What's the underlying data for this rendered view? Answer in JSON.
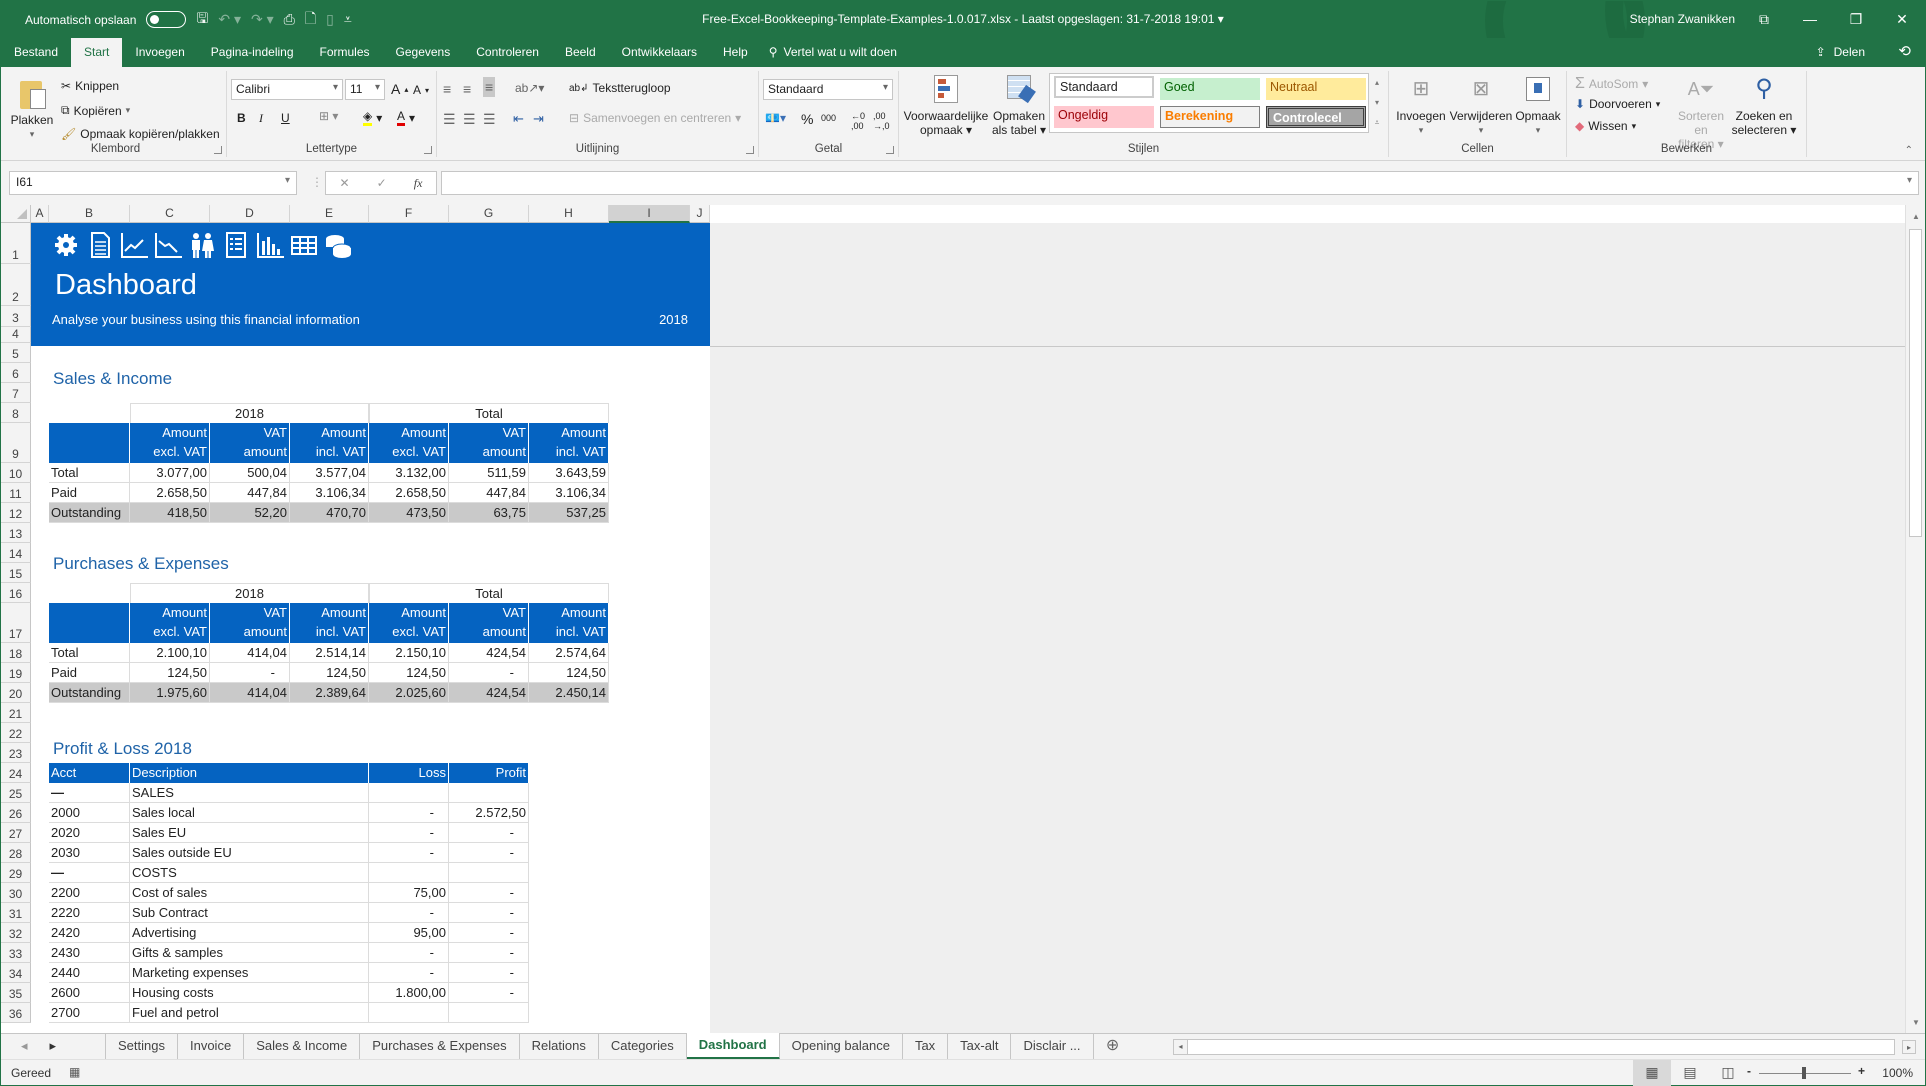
{
  "titlebar": {
    "autosave_label": "Automatisch opslaan",
    "document_title": "Free-Excel-Bookkeeping-Template-Examples-1.0.017.xlsx  -  Laatst opgeslagen: 31-7-2018 19:01",
    "user": "Stephan Zwanikken"
  },
  "ribbon_tabs": [
    "Bestand",
    "Start",
    "Invoegen",
    "Pagina-indeling",
    "Formules",
    "Gegevens",
    "Controleren",
    "Beeld",
    "Ontwikkelaars",
    "Help"
  ],
  "tell_me": "Vertel wat u wilt doen",
  "share_label": "Delen",
  "ribbon": {
    "clipboard": {
      "paste": "Plakken",
      "cut": "Knippen",
      "copy": "Kopiëren",
      "format_painter": "Opmaak kopiëren/plakken",
      "label": "Klembord"
    },
    "font": {
      "family": "Calibri",
      "size": "11",
      "bold": "B",
      "italic": "I",
      "underline": "U",
      "label": "Lettertype"
    },
    "alignment": {
      "wrap": "Tekstterugloop",
      "merge": "Samenvoegen en centreren",
      "label": "Uitlijning"
    },
    "number": {
      "format": "Standaard",
      "percent": "%",
      "thousands": "000",
      "label": "Getal"
    },
    "styles": {
      "conditional": [
        "Voorwaardelijke",
        "opmaak"
      ],
      "as_table": [
        "Opmaken",
        "als tabel"
      ],
      "cells": [
        "Standaard",
        "Goed",
        "Neutraal",
        "Ongeldig",
        "Berekening",
        "Controlecel"
      ],
      "label": "Stijlen"
    },
    "cells": {
      "insert": "Invoegen",
      "delete": "Verwijderen",
      "format": "Opmaak",
      "label": "Cellen"
    },
    "editing": {
      "autosum": "AutoSom",
      "fill": "Doorvoeren",
      "clear": "Wissen",
      "sort": [
        "Sorteren en",
        "filteren"
      ],
      "find": [
        "Zoeken en",
        "selecteren"
      ],
      "label": "Bewerken"
    }
  },
  "formula_bar": {
    "name_box": "I61",
    "fx": "fx",
    "formula": ""
  },
  "columns": [
    "A",
    "B",
    "C",
    "D",
    "E",
    "F",
    "G",
    "H",
    "I",
    "J"
  ],
  "selected_column": "I",
  "rows": [
    "1",
    "2",
    "3",
    "4",
    "5",
    "6",
    "7",
    "8",
    "9",
    "10",
    "11",
    "12",
    "13",
    "14",
    "15",
    "16",
    "17",
    "18",
    "19",
    "20",
    "21",
    "22",
    "23",
    "24",
    "25",
    "26",
    "27",
    "28",
    "29",
    "30",
    "31",
    "32",
    "33",
    "34",
    "35",
    "36"
  ],
  "banner": {
    "title": "Dashboard",
    "subtitle": "Analyse your business using this financial information",
    "year": "2018",
    "icons": [
      "gear-icon",
      "document-icon",
      "chart-up-icon",
      "chart-down-icon",
      "people-icon",
      "list-icon",
      "bar-chart-icon",
      "table-icon",
      "coins-icon"
    ]
  },
  "sales": {
    "title": "Sales & Income",
    "groups": [
      "2018",
      "Total"
    ],
    "headers": [
      [
        "Amount",
        "excl. VAT"
      ],
      [
        "VAT",
        "amount"
      ],
      [
        "Amount",
        "incl. VAT"
      ],
      [
        "Amount",
        "excl. VAT"
      ],
      [
        "VAT",
        "amount"
      ],
      [
        "Amount",
        "incl. VAT"
      ]
    ],
    "rows": [
      {
        "label": "Total",
        "values": [
          "3.077,00",
          "500,04",
          "3.577,04",
          "3.132,00",
          "511,59",
          "3.643,59"
        ]
      },
      {
        "label": "Paid",
        "values": [
          "2.658,50",
          "447,84",
          "3.106,34",
          "2.658,50",
          "447,84",
          "3.106,34"
        ]
      },
      {
        "label": "Outstanding",
        "values": [
          "418,50",
          "52,20",
          "470,70",
          "473,50",
          "63,75",
          "537,25"
        ]
      }
    ]
  },
  "purchases": {
    "title": "Purchases & Expenses",
    "groups": [
      "2018",
      "Total"
    ],
    "headers": [
      [
        "Amount",
        "excl. VAT"
      ],
      [
        "VAT",
        "amount"
      ],
      [
        "Amount",
        "incl. VAT"
      ],
      [
        "Amount",
        "excl. VAT"
      ],
      [
        "VAT",
        "amount"
      ],
      [
        "Amount",
        "incl. VAT"
      ]
    ],
    "rows": [
      {
        "label": "Total",
        "values": [
          "2.100,10",
          "414,04",
          "2.514,14",
          "2.150,10",
          "424,54",
          "2.574,64"
        ]
      },
      {
        "label": "Paid",
        "values": [
          "124,50",
          "-",
          "124,50",
          "124,50",
          "-",
          "124,50"
        ]
      },
      {
        "label": "Outstanding",
        "values": [
          "1.975,60",
          "414,04",
          "2.389,64",
          "2.025,60",
          "424,54",
          "2.450,14"
        ]
      }
    ]
  },
  "pnl": {
    "title": "Profit & Loss 2018",
    "headers": [
      "Acct",
      "Description",
      "Loss",
      "Profit"
    ],
    "rows": [
      {
        "acct": "—",
        "desc": "SALES",
        "loss": "",
        "profit": ""
      },
      {
        "acct": "2000",
        "desc": "Sales local",
        "loss": "-",
        "profit": "2.572,50"
      },
      {
        "acct": "2020",
        "desc": "Sales EU",
        "loss": "-",
        "profit": "-"
      },
      {
        "acct": "2030",
        "desc": "Sales outside EU",
        "loss": "-",
        "profit": "-"
      },
      {
        "acct": "—",
        "desc": "COSTS",
        "loss": "",
        "profit": ""
      },
      {
        "acct": "2200",
        "desc": "Cost of sales",
        "loss": "75,00",
        "profit": "-"
      },
      {
        "acct": "2220",
        "desc": "Sub Contract",
        "loss": "-",
        "profit": "-"
      },
      {
        "acct": "2420",
        "desc": "Advertising",
        "loss": "95,00",
        "profit": "-"
      },
      {
        "acct": "2430",
        "desc": "Gifts & samples",
        "loss": "-",
        "profit": "-"
      },
      {
        "acct": "2440",
        "desc": "Marketing expenses",
        "loss": "-",
        "profit": "-"
      },
      {
        "acct": "2600",
        "desc": "Housing costs",
        "loss": "1.800,00",
        "profit": "-"
      },
      {
        "acct": "2700",
        "desc": "Fuel and petrol",
        "loss": "",
        "profit": ""
      }
    ]
  },
  "sheet_tabs": [
    "Settings",
    "Invoice",
    "Sales & Income",
    "Purchases & Expenses",
    "Relations",
    "Categories",
    "Dashboard",
    "Opening balance",
    "Tax",
    "Tax-alt",
    "Disclair ..."
  ],
  "active_sheet": "Dashboard",
  "status": {
    "text": "Gereed",
    "zoom": "100%"
  },
  "colors": {
    "excel_green": "#217346",
    "banner_blue": "#0563c1",
    "section_title": "#1f63a8",
    "outstanding_grey": "#c9c9c9"
  }
}
